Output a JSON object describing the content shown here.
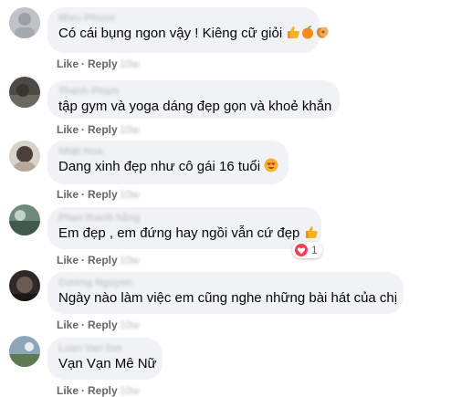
{
  "comments": [
    {
      "author": "Mieu Phuon",
      "text": "Có cái bụng ngon vậy ! Kiêng cữ giỏi",
      "emojis": [
        "thumbs-up-emoji",
        "tangerine-emoji",
        "clapping-hands-emoji"
      ],
      "like": "Like",
      "reply": "Reply",
      "time": "10w"
    },
    {
      "author": "Thanh Phạm",
      "text": "tập gym và yoga dáng đẹp gọn và khoẻ khắn",
      "like": "Like",
      "reply": "Reply",
      "time": "10w"
    },
    {
      "author": "Nhật Hoa",
      "text": "Dang xinh đẹp như cô gái 16 tuổi",
      "emojis": [
        "heart-eyes-emoji"
      ],
      "like": "Like",
      "reply": "Reply",
      "time": "10w"
    },
    {
      "author": "Phan thanh hằng",
      "text": "Em đẹp , em đứng hay ngồi vẫn cứ đẹp",
      "emojis": [
        "thumbs-up-emoji"
      ],
      "like": "Like",
      "reply": "Reply",
      "time": "10w",
      "reaction_count": "1"
    },
    {
      "author": "Cường Nguyen",
      "text": "Ngày nào làm việc em cũng nghe những bài hát của chị",
      "like": "Like",
      "reply": "Reply",
      "time": "10w"
    },
    {
      "author": "Luan Van Dm",
      "text": "Vạn Vạn Mê Nữ",
      "like": "Like",
      "reply": "Reply",
      "time": "10w"
    }
  ],
  "colors": {
    "bubble": "#f0f2f5",
    "action_text": "#65676b",
    "love_reaction": "#f33e58",
    "like_emoji": "#f7b125"
  }
}
